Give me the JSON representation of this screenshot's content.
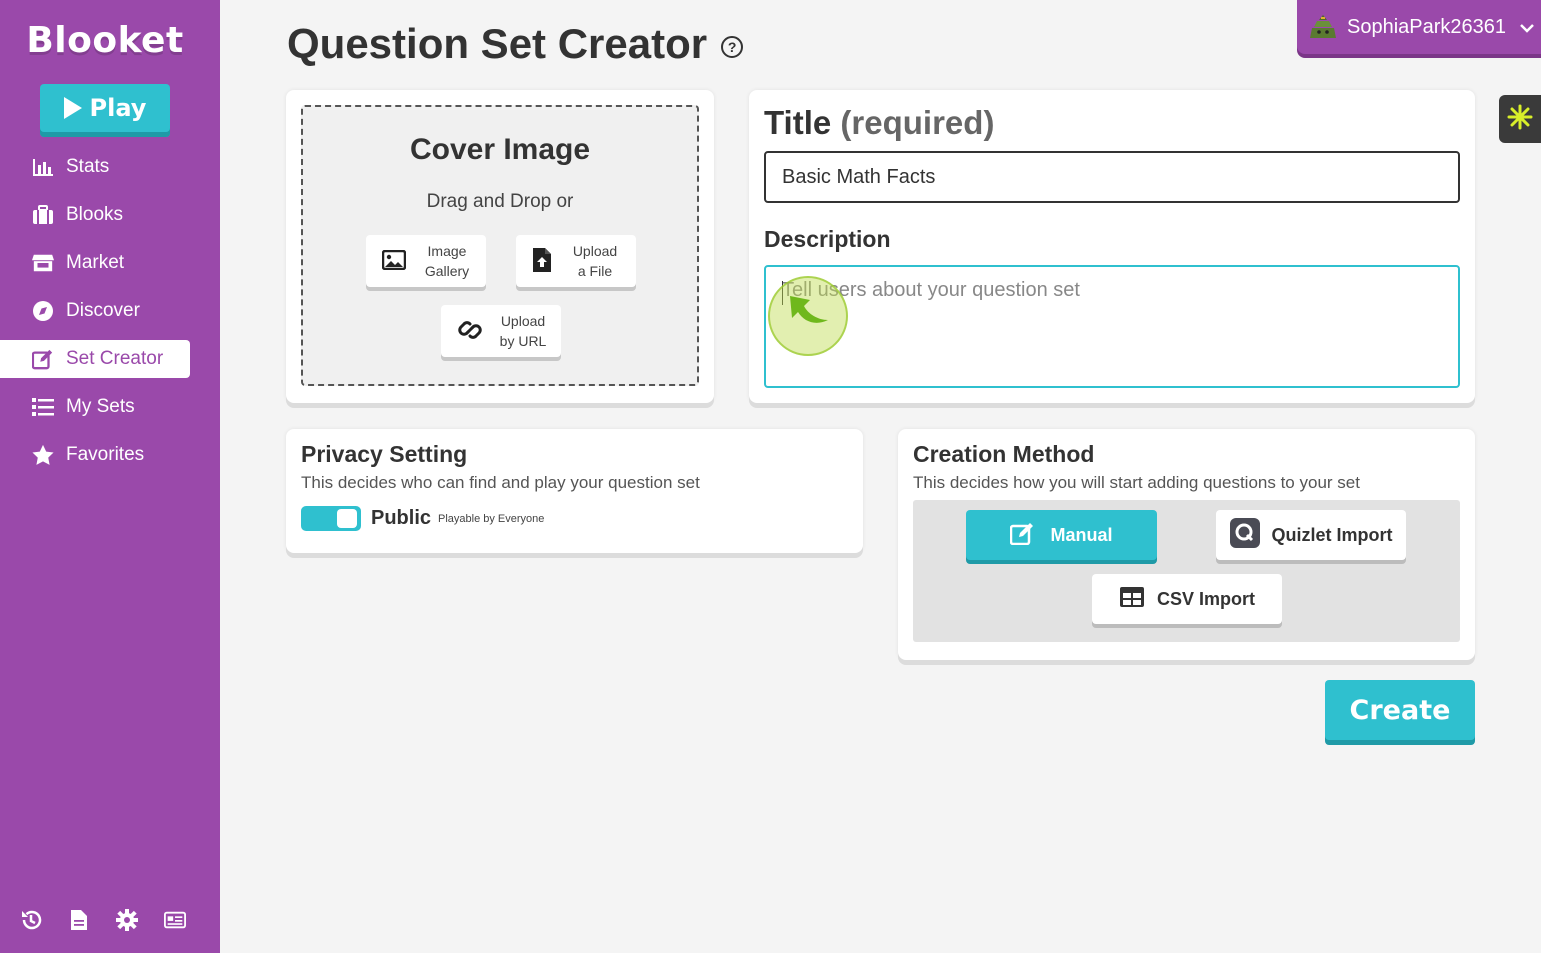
{
  "brand": {
    "logo": "Blooket",
    "accent": "#9a49aa",
    "teal": "#2fc0cf"
  },
  "sidebar": {
    "play_label": "Play",
    "items": [
      {
        "label": "Stats",
        "icon": "stats-icon"
      },
      {
        "label": "Blooks",
        "icon": "blooks-icon"
      },
      {
        "label": "Market",
        "icon": "market-icon"
      },
      {
        "label": "Discover",
        "icon": "compass-icon"
      },
      {
        "label": "Set Creator",
        "icon": "edit-icon",
        "active": true
      },
      {
        "label": "My Sets",
        "icon": "list-icon"
      },
      {
        "label": "Favorites",
        "icon": "star-icon"
      }
    ],
    "bottom_icons": [
      "history-icon",
      "document-icon",
      "gear-icon",
      "news-icon"
    ]
  },
  "header": {
    "title": "Question Set Creator",
    "help_icon": "?",
    "username": "SophiaPark26361"
  },
  "cover": {
    "title": "Cover Image",
    "subtitle": "Drag and Drop or",
    "buttons": [
      {
        "line1": "Image",
        "line2": "Gallery",
        "icon": "image-icon"
      },
      {
        "line1": "Upload",
        "line2": "a File",
        "icon": "file-upload-icon"
      },
      {
        "line1": "Upload",
        "line2": "by URL",
        "icon": "link-icon"
      }
    ]
  },
  "form": {
    "title_label": "Title",
    "title_required": "(required)",
    "title_value": "Basic Math Facts",
    "description_label": "Description",
    "description_placeholder": "Tell users about your question set"
  },
  "privacy": {
    "title": "Privacy Setting",
    "subtitle": "This decides who can find and play your question set",
    "toggle_on": true,
    "value_label": "Public",
    "value_sub": "Playable by Everyone"
  },
  "method": {
    "title": "Creation Method",
    "subtitle": "This decides how you will start adding questions to your set",
    "options": [
      {
        "label": "Manual",
        "selected": true,
        "icon": "edit-icon"
      },
      {
        "label": "Quizlet Import",
        "selected": false,
        "icon": "quizlet-icon"
      },
      {
        "label": "CSV Import",
        "selected": false,
        "icon": "table-icon"
      }
    ]
  },
  "actions": {
    "create_label": "Create"
  }
}
